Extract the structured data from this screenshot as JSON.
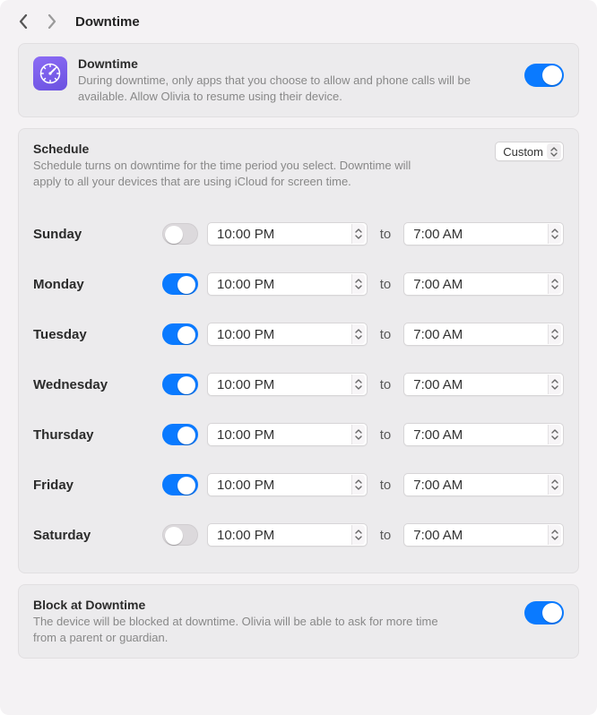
{
  "title": "Downtime",
  "hero": {
    "title": "Downtime",
    "desc": "During downtime, only apps that you choose to allow and phone calls will be available. Allow Olivia to resume using their device.",
    "toggle_on": true
  },
  "schedule": {
    "title": "Schedule",
    "desc": "Schedule turns on downtime for the time period you select. Downtime will apply to all your devices that are using iCloud for screen time.",
    "mode_label": "Custom",
    "to_label": "to",
    "days": [
      {
        "name": "Sunday",
        "enabled": false,
        "from": "10:00 PM",
        "to": "7:00 AM"
      },
      {
        "name": "Monday",
        "enabled": true,
        "from": "10:00 PM",
        "to": "7:00 AM"
      },
      {
        "name": "Tuesday",
        "enabled": true,
        "from": "10:00 PM",
        "to": "7:00 AM"
      },
      {
        "name": "Wednesday",
        "enabled": true,
        "from": "10:00 PM",
        "to": "7:00 AM"
      },
      {
        "name": "Thursday",
        "enabled": true,
        "from": "10:00 PM",
        "to": "7:00 AM"
      },
      {
        "name": "Friday",
        "enabled": true,
        "from": "10:00 PM",
        "to": "7:00 AM"
      },
      {
        "name": "Saturday",
        "enabled": false,
        "from": "10:00 PM",
        "to": "7:00 AM"
      }
    ]
  },
  "block": {
    "title": "Block at Downtime",
    "desc": "The device will be blocked at downtime. Olivia will be able to ask for more time from a parent or guardian.",
    "toggle_on": true
  },
  "colors": {
    "accent": "#0a7aff",
    "icon_bg": "#7a5ce6"
  }
}
